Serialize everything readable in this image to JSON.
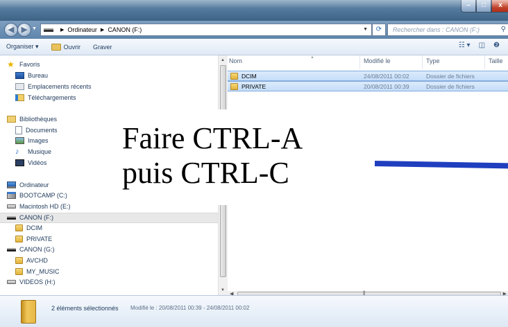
{
  "window": {
    "title": "",
    "controls": {
      "minimize": "–",
      "maximize": "□",
      "close": "x"
    }
  },
  "address_bar": {
    "path": [
      "Ordinateur",
      "CANON (F:)"
    ],
    "separator": "▶",
    "search_placeholder": "Rechercher dans : CANON (F:)"
  },
  "toolbar": {
    "organize": "Organiser ▾",
    "open": "Ouvrir",
    "burn": "Graver"
  },
  "nav_pane": {
    "favorites": {
      "label": "Favoris",
      "items": [
        "Bureau",
        "Emplacements récents",
        "Téléchargements"
      ]
    },
    "libraries": {
      "label": "Bibliothèques",
      "items": [
        "Documents",
        "Images",
        "Musique",
        "Vidéos"
      ]
    },
    "computer": {
      "label": "Ordinateur",
      "items": [
        "BOOTCAMP (C:)",
        "Macintosh HD (E:)",
        "CANON (F:)",
        "DCIM",
        "PRIVATE",
        "CANON (G:)",
        "AVCHD",
        "MY_MUSIC",
        "VIDEOS (H:)"
      ]
    }
  },
  "file_list": {
    "columns": {
      "name": "Nom",
      "modified": "Modifié le",
      "type": "Type",
      "size": "Taille"
    },
    "rows": [
      {
        "name": "DCIM",
        "modified": "24/08/2011 00:02",
        "type": "Dossier de fichiers"
      },
      {
        "name": "PRIVATE",
        "modified": "20/08/2011 00:39",
        "type": "Dossier de fichiers"
      }
    ]
  },
  "details": {
    "count": "2 éléments sélectionnés",
    "meta": "Modifié le : 20/08/2011 00:39 - 24/08/2011 00:02"
  },
  "overlay": {
    "line1": "Faire CTRL-A",
    "line2": "puis CTRL-C",
    "line_color": "#1f3fbf"
  }
}
